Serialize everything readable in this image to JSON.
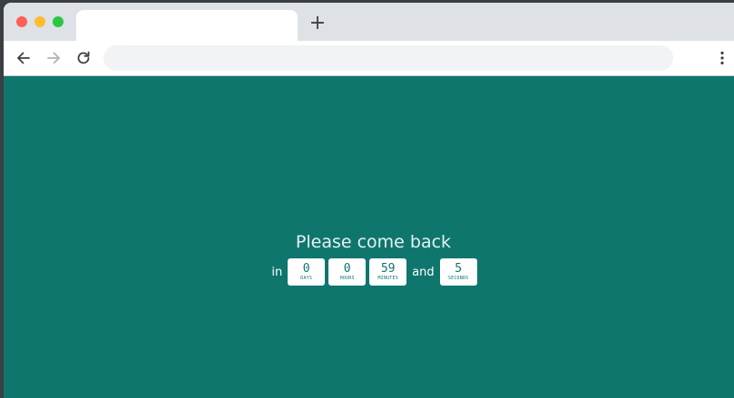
{
  "browser": {
    "tab_title": "",
    "new_tab_label": "+",
    "address": {
      "value": "",
      "placeholder": ""
    }
  },
  "page": {
    "message": "Please come back",
    "prefix": "in",
    "connector": "and",
    "countdown": {
      "days": {
        "value": "0",
        "label": "DAYS"
      },
      "hours": {
        "value": "0",
        "label": "HOURS"
      },
      "minutes": {
        "value": "59",
        "label": "MINUTES"
      },
      "seconds": {
        "value": "5",
        "label": "SECONDS"
      }
    },
    "colors": {
      "background": "#0f766e",
      "box": "#ffffff",
      "text": "#e6f2f1"
    }
  }
}
